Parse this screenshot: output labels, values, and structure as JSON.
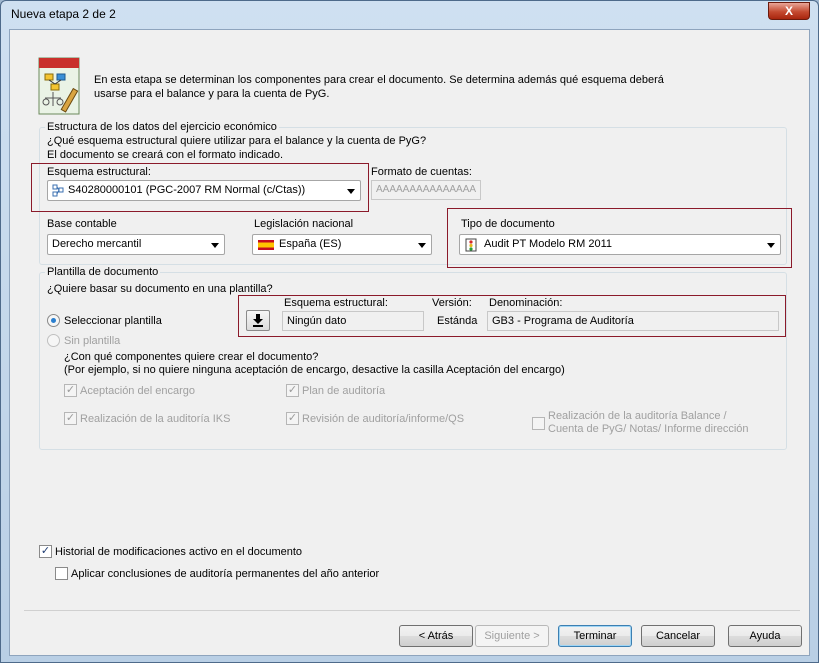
{
  "window": {
    "title": "Nueva etapa 2 de 2",
    "close_label": "X"
  },
  "intro": {
    "line1": "En esta etapa se determinan los componentes para crear el documento. Se determina además qué esquema deberá",
    "line2": "usarse para el balance y para la cuenta de PyG."
  },
  "estructura": {
    "group_title": "Estructura de los datos del ejercicio económico",
    "question": "¿Qué esquema estructural quiere utilizar para el balance y la cuenta de PyG?",
    "note": "El documento se creará con el formato indicado.",
    "esquema_label": "Esquema estructural:",
    "esquema_value": "S40280000101 (PGC-2007 RM Normal (c/Ctas))",
    "formato_label": "Formato de cuentas:",
    "formato_value": "AAAAAAAAAAAAAAA",
    "base_label": "Base contable",
    "base_value": "Derecho mercantil",
    "legislacion_label": "Legislación nacional",
    "legislacion_value": "España (ES)",
    "tipo_label": "Tipo de documento",
    "tipo_value": "Audit PT Modelo RM 2011"
  },
  "plantilla": {
    "group_title": "Plantilla de documento",
    "question": "¿Quiere basar su documento en una plantilla?",
    "opt_select": "Seleccionar plantilla",
    "opt_none": "Sin plantilla",
    "col_esquema": "Esquema estructural:",
    "col_version": "Versión:",
    "col_denom": "Denominación:",
    "val_esquema": "Ningún dato",
    "val_version": "Estánda",
    "val_denom": "GB3 - Programa de Auditoría",
    "components_q": "¿Con qué componentes quiere crear el documento?",
    "components_hint": "(Por ejemplo, si no quiere ninguna aceptación de encargo, desactive la casilla Aceptación del encargo)",
    "chk_aceptacion": "Aceptación del encargo",
    "chk_plan": "Plan de auditoría",
    "chk_iks": "Realización de la auditoría IKS",
    "chk_revision": "Revisión de auditoría/informe/QS",
    "chk_balance_l1": "Realización de la auditoría Balance /",
    "chk_balance_l2": "Cuenta de PyG/ Notas/ Informe dirección"
  },
  "options": {
    "historial": "Historial de modificaciones activo en el documento",
    "aplicar": "Aplicar conclusiones de auditoría permanentes del año anterior"
  },
  "buttons": {
    "back": "< Atrás",
    "next": "Siguiente >",
    "finish": "Terminar",
    "cancel": "Cancelar",
    "help": "Ayuda"
  },
  "colors": {
    "highlight_border": "#8b1a2a",
    "radio_accent": "#2a7fcf",
    "spain_red": "#c60b1e",
    "spain_yellow": "#ffc400"
  }
}
